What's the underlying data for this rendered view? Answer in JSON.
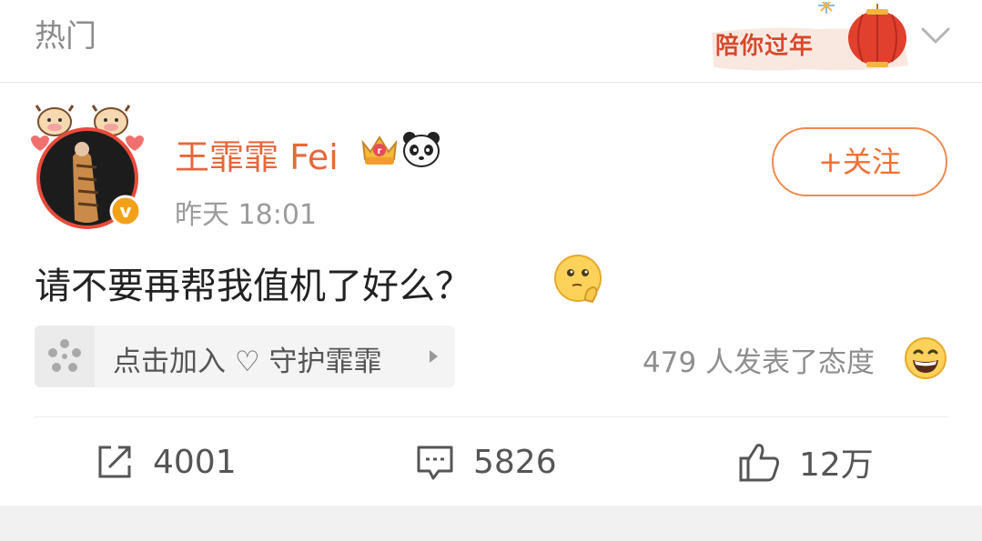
{
  "header": {
    "tab_label": "热门",
    "banner_text": "陪你过年",
    "chevron_icon": "chevron-down-icon"
  },
  "post": {
    "author": "王霏霏 Fei",
    "author_color": "#e8673a",
    "time": "昨天 18:01",
    "follow_label": "+关注",
    "text": "请不要再帮我值机了好么？",
    "super_topic": "点击加入 ♡ 守护霏霏",
    "attitude_text": "479 人发表了态度",
    "actions": {
      "repost_count": "4001",
      "comment_count": "5826",
      "like_count": "12万"
    }
  },
  "colors": {
    "accent": "#f07134",
    "text_gray": "#9b9b9b"
  }
}
